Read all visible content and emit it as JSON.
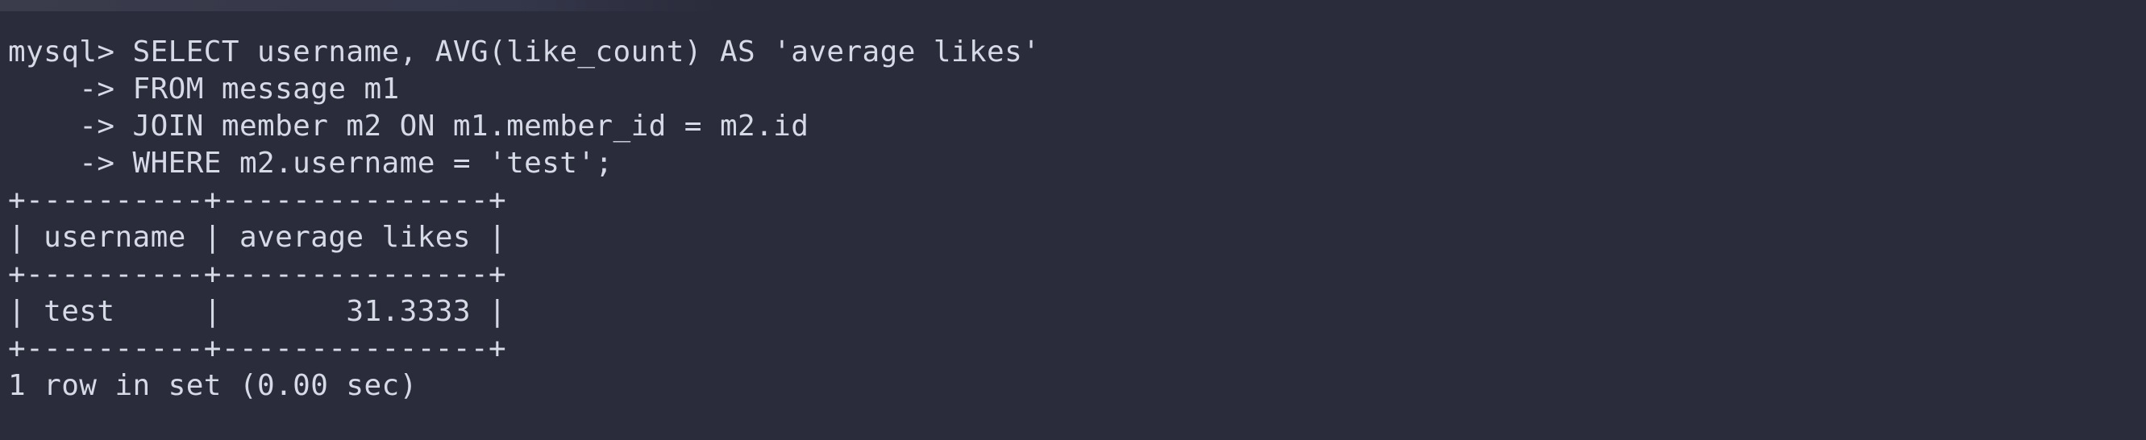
{
  "terminal": {
    "lines": [
      "mysql> SELECT username, AVG(like_count) AS 'average likes'",
      "    -> FROM message m1",
      "    -> JOIN member m2 ON m1.member_id = m2.id",
      "    -> WHERE m2.username = 'test';",
      "+----------+---------------+",
      "| username | average likes |",
      "+----------+---------------+",
      "| test     |       31.3333 |",
      "+----------+---------------+",
      "1 row in set (0.00 sec)"
    ]
  },
  "query_result": {
    "columns": [
      "username",
      "average likes"
    ],
    "rows": [
      [
        "test",
        "31.3333"
      ]
    ],
    "status": "1 row in set (0.00 sec)"
  }
}
